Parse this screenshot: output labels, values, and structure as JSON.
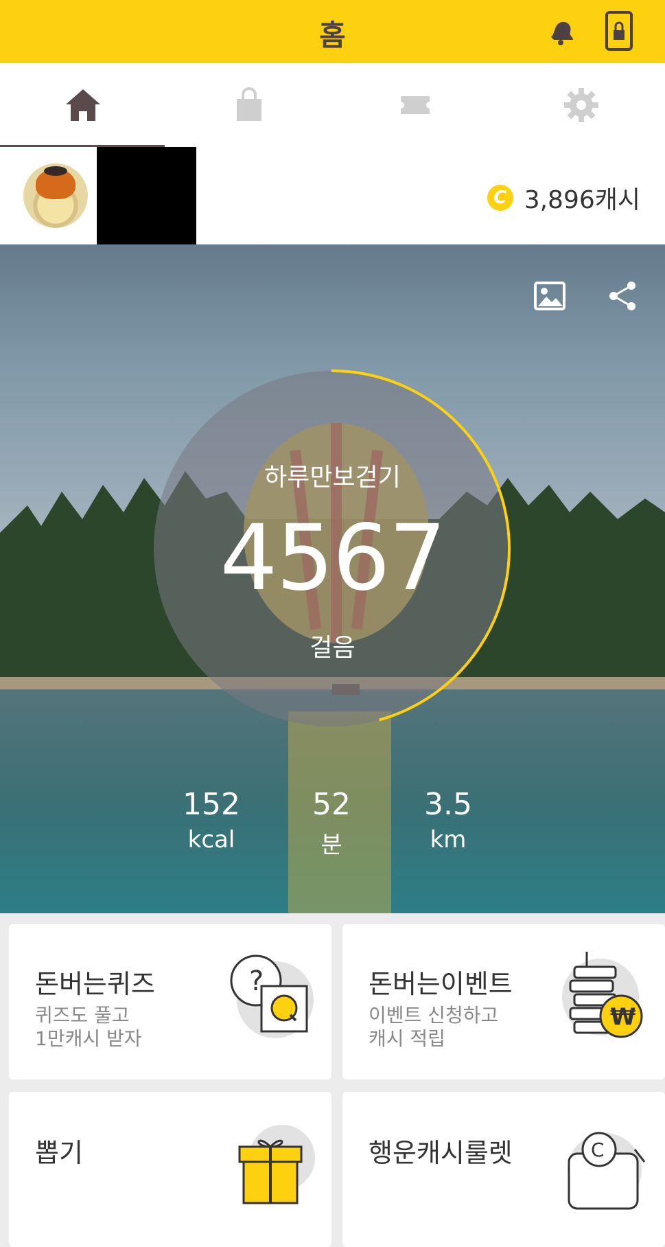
{
  "header": {
    "title": "홈",
    "notification_icon": "bell-icon",
    "lock_icon": "phone-lock-icon",
    "accent_color": "#fdd110"
  },
  "tabs": [
    {
      "name": "home",
      "icon": "home-icon",
      "active": true
    },
    {
      "name": "shop",
      "icon": "shopping-bag-icon",
      "active": false
    },
    {
      "name": "coupon",
      "icon": "ticket-icon",
      "active": false
    },
    {
      "name": "settings",
      "icon": "gear-icon",
      "active": false
    }
  ],
  "profile": {
    "cash_amount": "3,896캐시",
    "coin_symbol": "C"
  },
  "hero": {
    "title": "하루만보걷기",
    "steps": "4567",
    "steps_unit": "걸음",
    "goal_progress": 0.4567,
    "stats": [
      {
        "value": "152",
        "unit": "kcal"
      },
      {
        "value": "52",
        "unit": "분"
      },
      {
        "value": "3.5",
        "unit": "km"
      }
    ]
  },
  "cards": [
    {
      "title": "돈버는퀴즈",
      "sub1": "퀴즈도 풀고",
      "sub2": "1만캐시 받자",
      "icon": "quiz-icon"
    },
    {
      "title": "돈버는이벤트",
      "sub1": "이벤트 신청하고",
      "sub2": "캐시 적립",
      "icon": "coin-stack-icon"
    },
    {
      "title": "뽑기",
      "sub1": "",
      "sub2": "",
      "icon": "gift-icon"
    },
    {
      "title": "행운캐시룰렛",
      "sub1": "",
      "sub2": "",
      "icon": "roulette-icon"
    }
  ]
}
